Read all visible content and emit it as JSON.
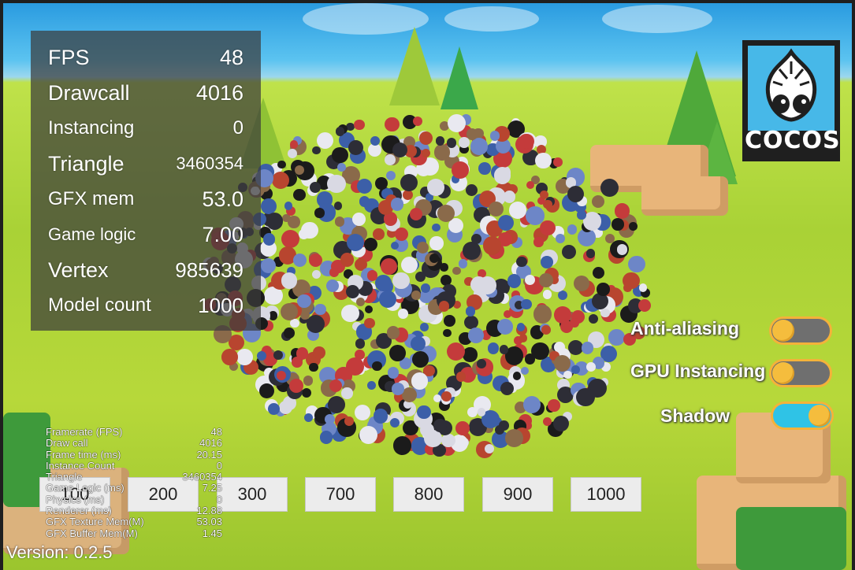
{
  "stats_panel": [
    {
      "label": "FPS",
      "value": "48"
    },
    {
      "label": "Drawcall",
      "value": "4016"
    },
    {
      "label": "Instancing",
      "value": "0"
    },
    {
      "label": "Triangle",
      "value": "3460354"
    },
    {
      "label": "GFX mem",
      "value": "53.0"
    },
    {
      "label": "Game logic",
      "value": "7.00"
    },
    {
      "label": "Vertex",
      "value": "985639"
    },
    {
      "label": "Model count",
      "value": "1000"
    }
  ],
  "logo": {
    "text": "COCOS",
    "icon": "cocos-logo-icon"
  },
  "toggles": [
    {
      "label": "Anti-aliasing",
      "on": false
    },
    {
      "label": "GPU Instancing",
      "on": false
    },
    {
      "label": "Shadow",
      "on": true
    }
  ],
  "debug_stats": [
    {
      "label": "Framerate (FPS)",
      "value": "48"
    },
    {
      "label": "Draw call",
      "value": "4016"
    },
    {
      "label": "Frame time (ms)",
      "value": "20.15"
    },
    {
      "label": "Instance Count",
      "value": "0"
    },
    {
      "label": "Triangle",
      "value": "3460354"
    },
    {
      "label": "Game Logic (ms)",
      "value": "7.25"
    },
    {
      "label": "Physics (ms)",
      "value": "0"
    },
    {
      "label": "Renderer (ms)",
      "value": "12.88"
    },
    {
      "label": "GFX Texture Mem(M)",
      "value": "53.03"
    },
    {
      "label": "GFX Buffer Mem(M)",
      "value": "1.45"
    }
  ],
  "count_buttons": [
    "100",
    "200",
    "300",
    "700",
    "800",
    "900",
    "1000"
  ],
  "version": "Version: 0.2.5",
  "colors": {
    "toggle_off_track": "#6f6f6f",
    "toggle_on_track": "#2fc3e6",
    "toggle_knob": "#f5bd3d",
    "panel_bg": "rgba(60,60,60,0.72)"
  }
}
